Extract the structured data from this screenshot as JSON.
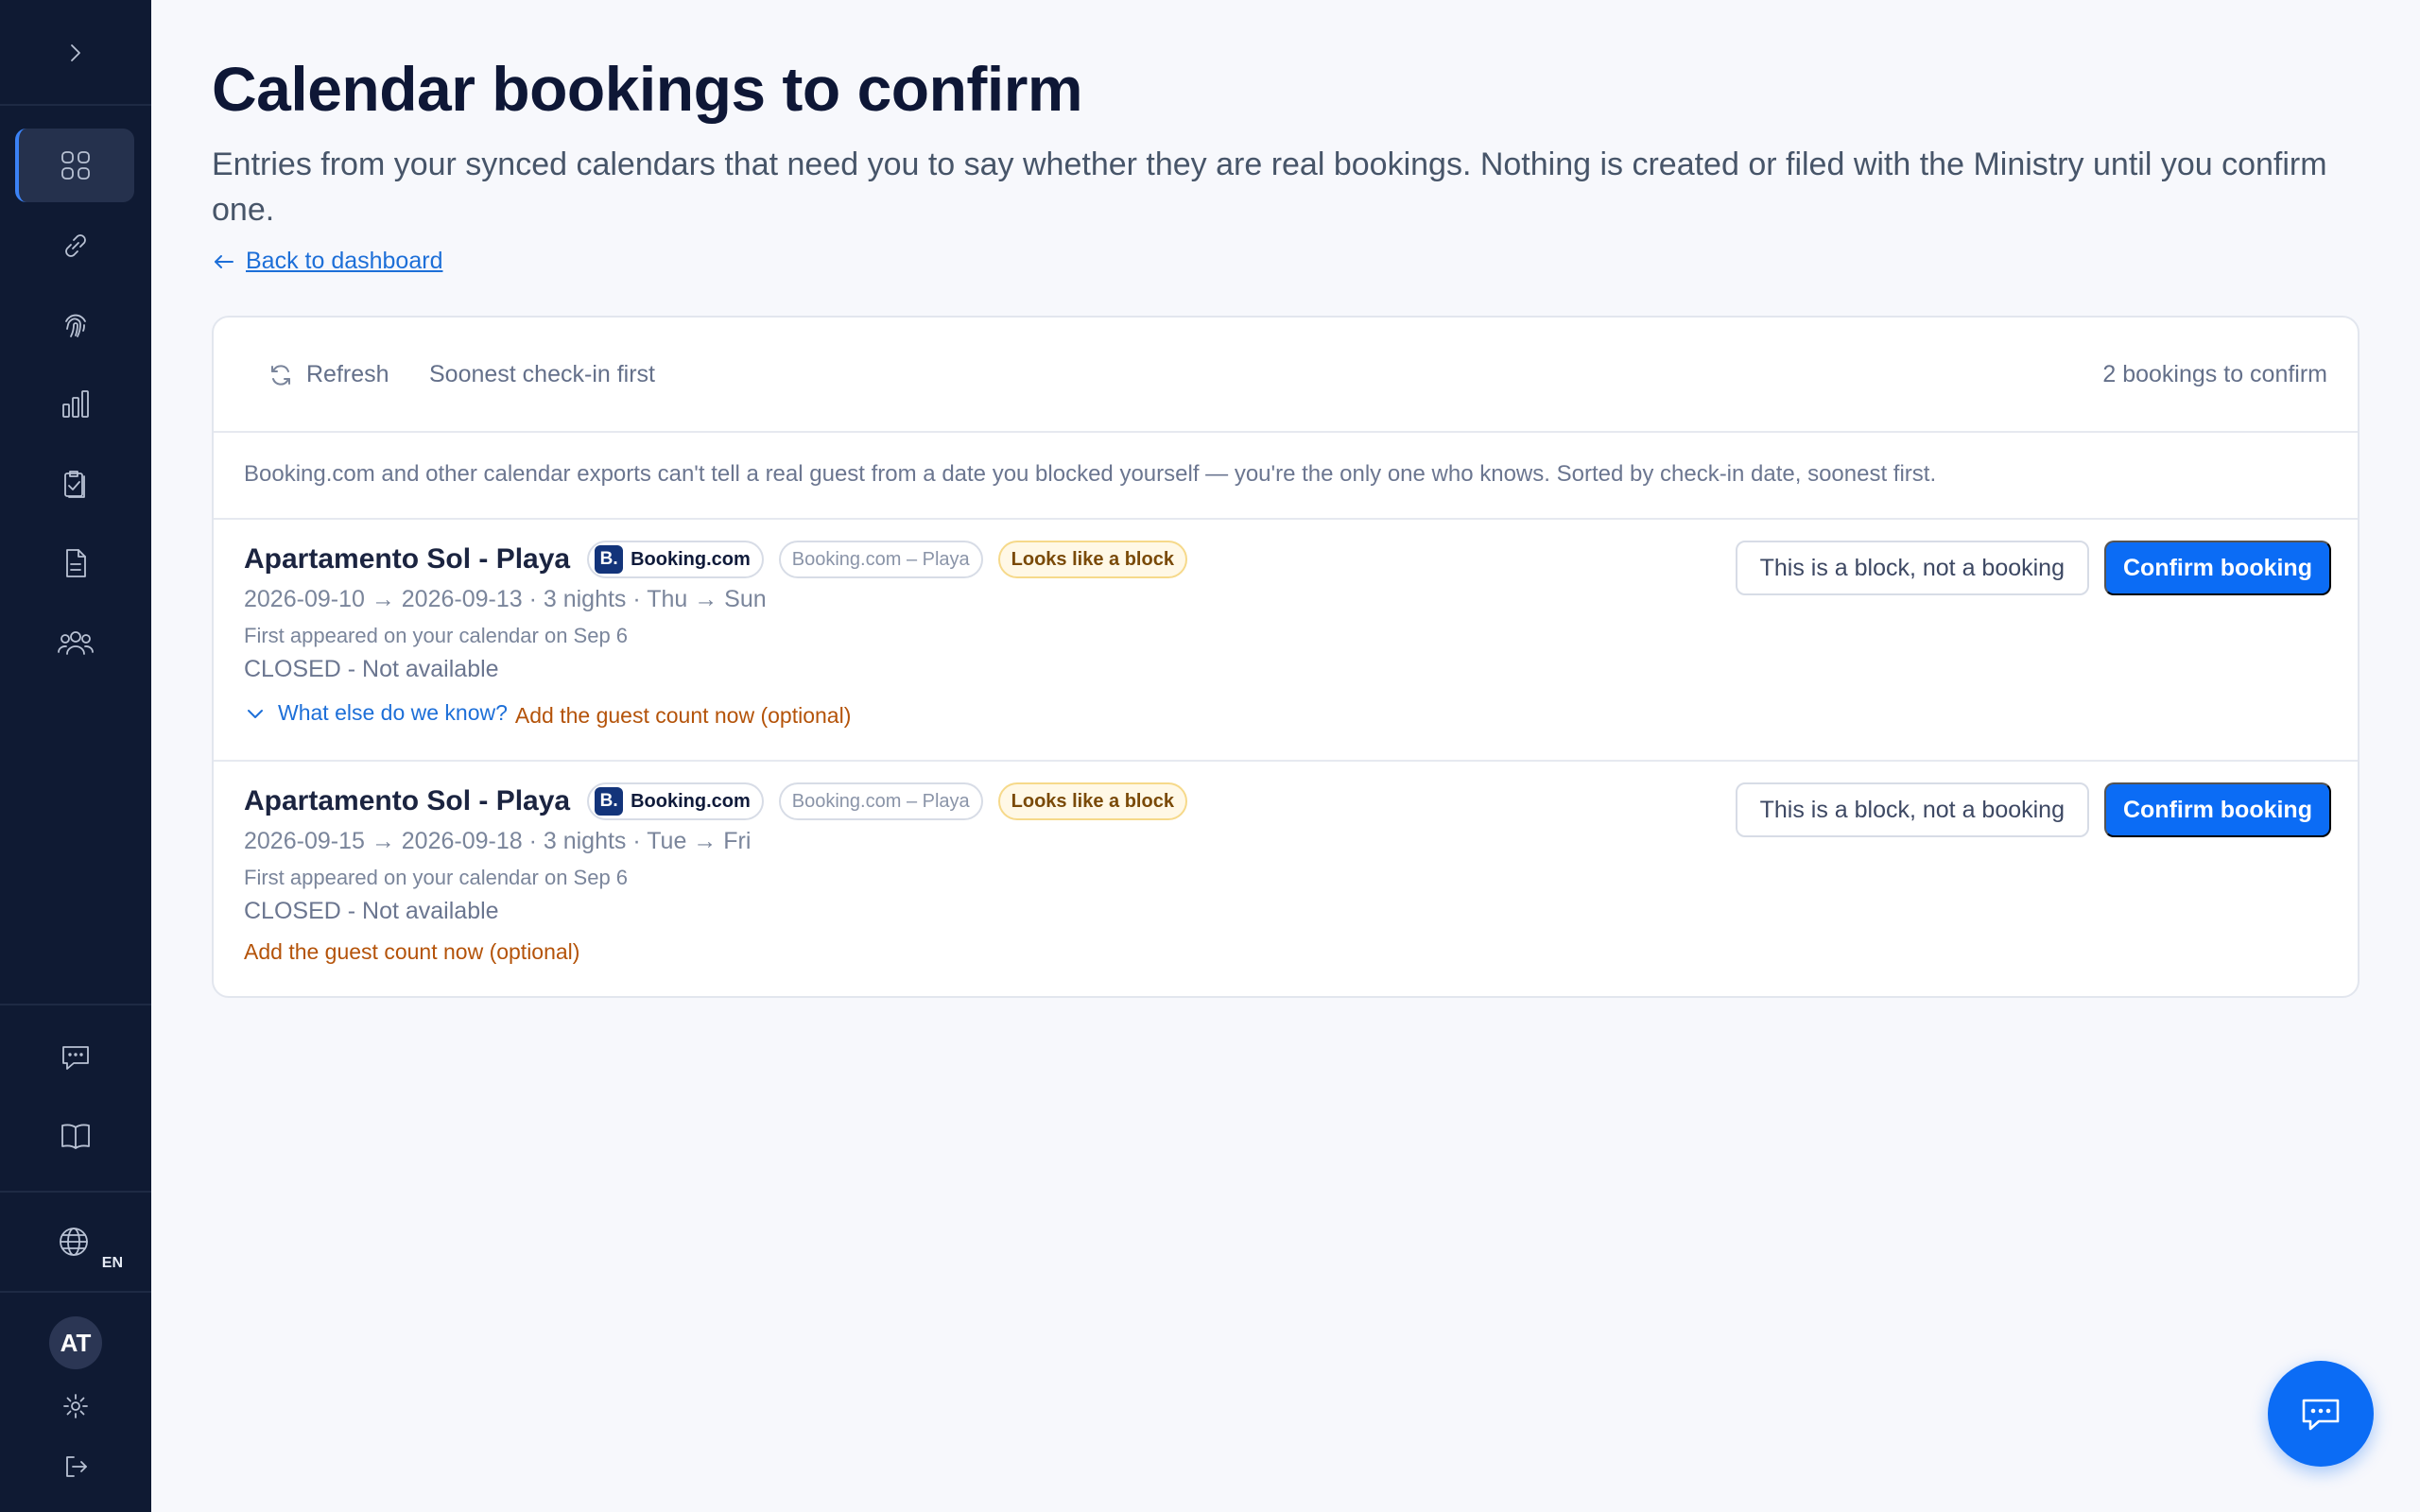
{
  "sidebar": {
    "lang": "EN",
    "avatar_initials": "AT",
    "icons": [
      "chevron-right-icon",
      "dashboard-grid-icon",
      "link-icon",
      "fingerprint-icon",
      "bar-chart-icon",
      "clipboard-check-icon",
      "document-icon",
      "users-icon",
      "chat-icon",
      "book-icon",
      "globe-icon",
      "gear-icon",
      "logout-icon"
    ]
  },
  "page": {
    "title": "Calendar bookings to confirm",
    "subtitle": "Entries from your synced calendars that need you to say whether they are real bookings. Nothing is created or filed with the Ministry until you confirm one.",
    "back_link": "Back to dashboard"
  },
  "toolbar": {
    "refresh": "Refresh",
    "sort": "Soonest check-in first",
    "count": "2 bookings to confirm"
  },
  "note": "Booking.com and other calendar exports can't tell a real guest from a date you blocked yourself — you're the only one who knows. Sorted by check-in date, soonest first.",
  "bookings": [
    {
      "property": "Apartamento Sol - Playa",
      "source_logo": "B.",
      "source": "Booking.com",
      "calendar": "Booking.com – Playa",
      "flag": "Looks like a block",
      "dates": "2026-09-10 → 2026-09-13 · 3 nights · Thu → Sun",
      "first_seen": "First appeared on your calendar on Sep 6",
      "status": "CLOSED - Not available",
      "more": "What else do we know?",
      "guest_link": "Add the guest count now (optional)",
      "block_btn": "This is a block, not a booking",
      "confirm_btn": "Confirm booking"
    },
    {
      "property": "Apartamento Sol - Playa",
      "source_logo": "B.",
      "source": "Booking.com",
      "calendar": "Booking.com – Playa",
      "flag": "Looks like a block",
      "dates": "2026-09-15 → 2026-09-18 · 3 nights · Tue → Fri",
      "first_seen": "First appeared on your calendar on Sep 6",
      "status": "CLOSED - Not available",
      "guest_link": "Add the guest count now (optional)",
      "block_btn": "This is a block, not a booking",
      "confirm_btn": "Confirm booking"
    }
  ],
  "colors": {
    "sidebar_bg": "#0f1a33",
    "accent": "#0b6cf5",
    "warning_text": "#b45309",
    "page_bg": "#f7f8fc"
  }
}
